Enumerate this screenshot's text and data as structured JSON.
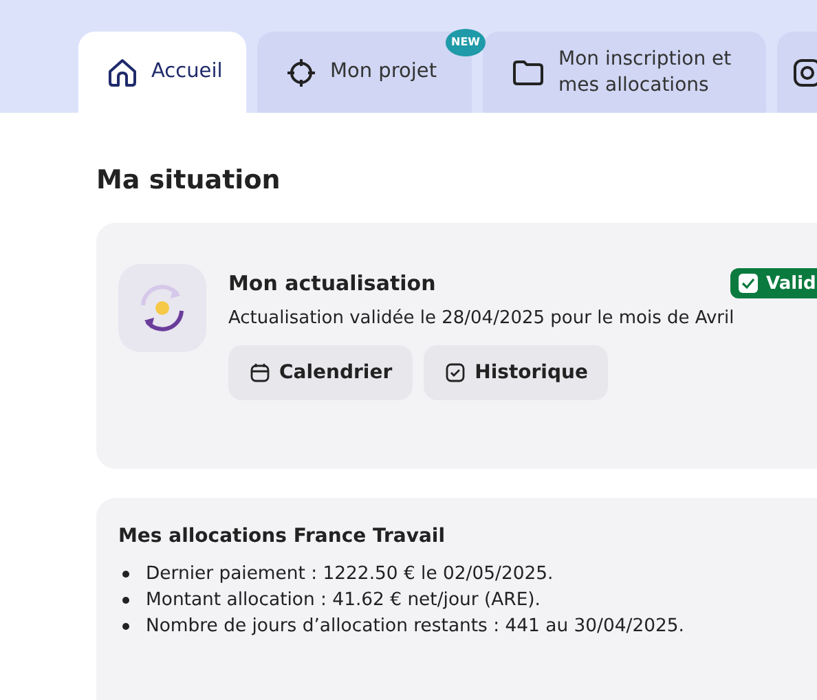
{
  "tabs": [
    {
      "label": "Accueil",
      "selected": true
    },
    {
      "label": "Mon projet",
      "selected": false,
      "badge": "NEW"
    },
    {
      "label": "Mon inscription et mes allocations",
      "selected": false
    },
    {
      "selected": false
    }
  ],
  "heading": "Ma situation",
  "actualisation": {
    "title": "Mon actualisation",
    "status": "Valid",
    "text": "Actualisation validée le 28/04/2025 pour le mois de Avril",
    "buttons": [
      {
        "label": "Calendrier"
      },
      {
        "label": "Historique"
      }
    ]
  },
  "allocations": {
    "title": "Mes allocations France Travail",
    "items": [
      "Dernier paiement : 1222.50 € le 02/05/2025.",
      "Montant allocation : 41.62 € net/jour (ARE).",
      "Nombre de jours d’allocation restants : 441 au 30/04/2025."
    ]
  }
}
